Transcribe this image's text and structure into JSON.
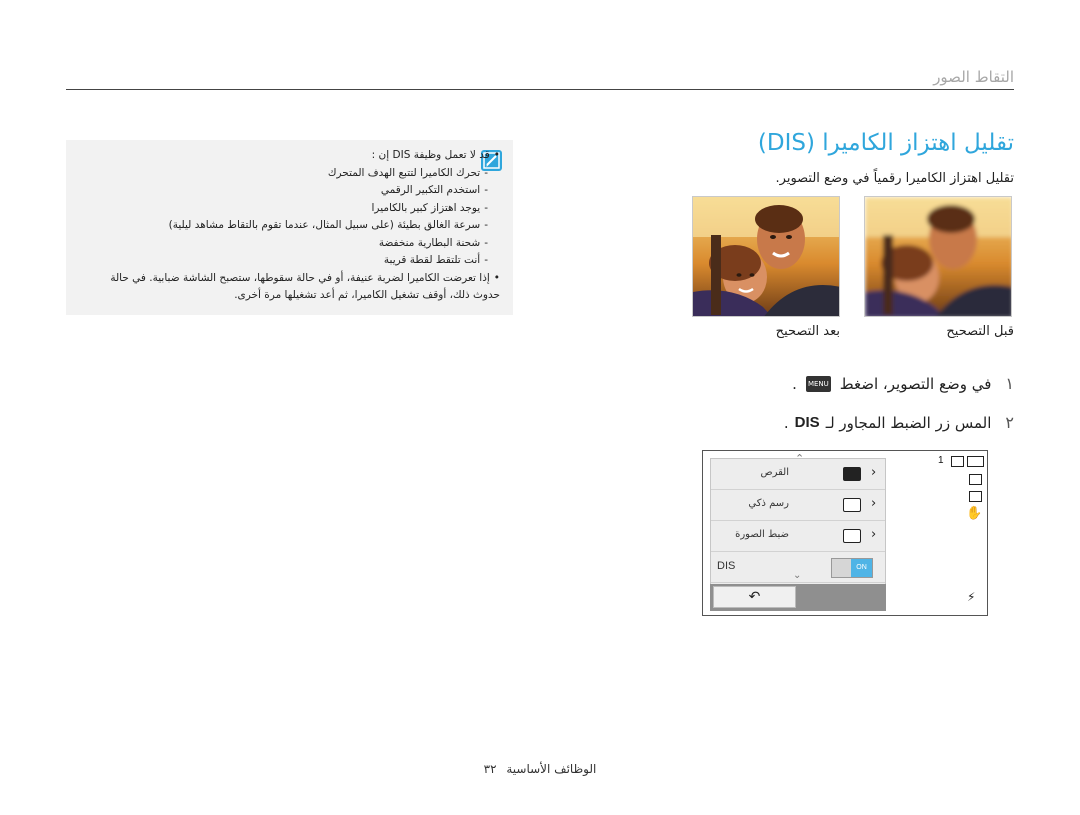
{
  "header": {
    "section": "التقاط الصور"
  },
  "title": {
    "text": "تقليل اهتزاز الكاميرا (DIS)"
  },
  "intro": "تقليل اهتزاز الكاميرا رقمياً في وضع التصوير.",
  "captions": {
    "before": "قبل التصحيح",
    "after": "بعد التصحيح"
  },
  "steps": [
    {
      "num": "١",
      "text_before": "في وضع التصوير، اضغط",
      "menu_badge": "MENU",
      "text_after": "."
    },
    {
      "num": "٢",
      "text_before": "المس زر الضبط المجاور لـ",
      "bold": "DIS",
      "text_after": "."
    }
  ],
  "note": {
    "items": [
      {
        "type": "bullet",
        "text": "قد لا تعمل وظيفة DIS إن :"
      },
      {
        "type": "sub",
        "text": "تحرك الكاميرا لتتبع الهدف المتحرك"
      },
      {
        "type": "sub",
        "text": "استخدم التكبير الرقمي"
      },
      {
        "type": "sub",
        "text": "يوجد اهتزاز كبير بالكاميرا"
      },
      {
        "type": "sub",
        "text": "سرعة الغالق بطيئة (على سبيل المثال، عندما تقوم بالتقاط مشاهد ليلية)"
      },
      {
        "type": "sub",
        "text": "شحنة البطارية منخفضة"
      },
      {
        "type": "sub",
        "text": "أنت تلتقط لقطة قريبة"
      },
      {
        "type": "bullet",
        "text": "إذا تعرضت الكاميرا لضربة عنيفة، أو في حالة سقوطها، ستصبح الشاشة ضبابية. في حالة حدوث ذلك، أوقف تشغيل الكاميرا، ثم أعد تشغيلها مرة أخرى."
      }
    ]
  },
  "camera": {
    "rows": [
      {
        "label": "القرص"
      },
      {
        "label": "رسم ذكي"
      },
      {
        "label": "ضبط الصورة"
      },
      {
        "label_left": "DIS",
        "toggle": "ON"
      }
    ],
    "count": "1"
  },
  "footer": {
    "text": "الوظائف الأساسية",
    "page": "٣٢"
  },
  "colors": {
    "accent": "#2fa6dc",
    "toggle_on": "#4fb4e6"
  }
}
